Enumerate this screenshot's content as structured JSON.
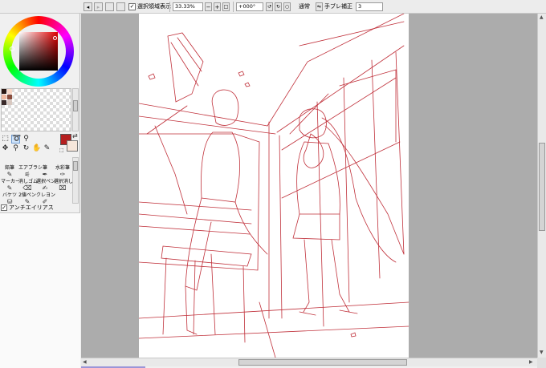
{
  "toolbar": {
    "show_selection_label": "選択領域表示",
    "show_selection_checked": "✓",
    "zoom": "33.33%",
    "rotation": "+000°",
    "blend_mode": "通常",
    "stabilizer_label": "手ブレ補正",
    "stabilizer_value": "3"
  },
  "tools": {
    "antialias_label": "アンチエイリアス",
    "antialias_checked": "✓",
    "brushes": [
      {
        "label": "鉛筆",
        "icon": "pencil"
      },
      {
        "label": "エアブラシ",
        "icon": "airbrush"
      },
      {
        "label": "筆",
        "icon": "brush"
      },
      {
        "label": "水彩筆",
        "icon": "watercolor"
      },
      {
        "label": "マーカー",
        "icon": "marker"
      },
      {
        "label": "消しゴム",
        "icon": "eraser"
      },
      {
        "label": "選択ペン",
        "icon": "select-pen"
      },
      {
        "label": "選択消し",
        "icon": "select-eraser"
      },
      {
        "label": "バケツ",
        "icon": "bucket"
      },
      {
        "label": "2値ペン",
        "icon": "binary-pen"
      },
      {
        "label": "クレヨン",
        "icon": "crayon"
      }
    ]
  },
  "colors": {
    "main": "#b51f1f",
    "sub": "#f6e6da",
    "lineart": "#c0303a",
    "swatches": [
      "#2a1712",
      "#f8d8c8",
      "#f0b9a0",
      "#8a4c3c",
      "#3a2a2a",
      "#d8c8c0"
    ]
  }
}
